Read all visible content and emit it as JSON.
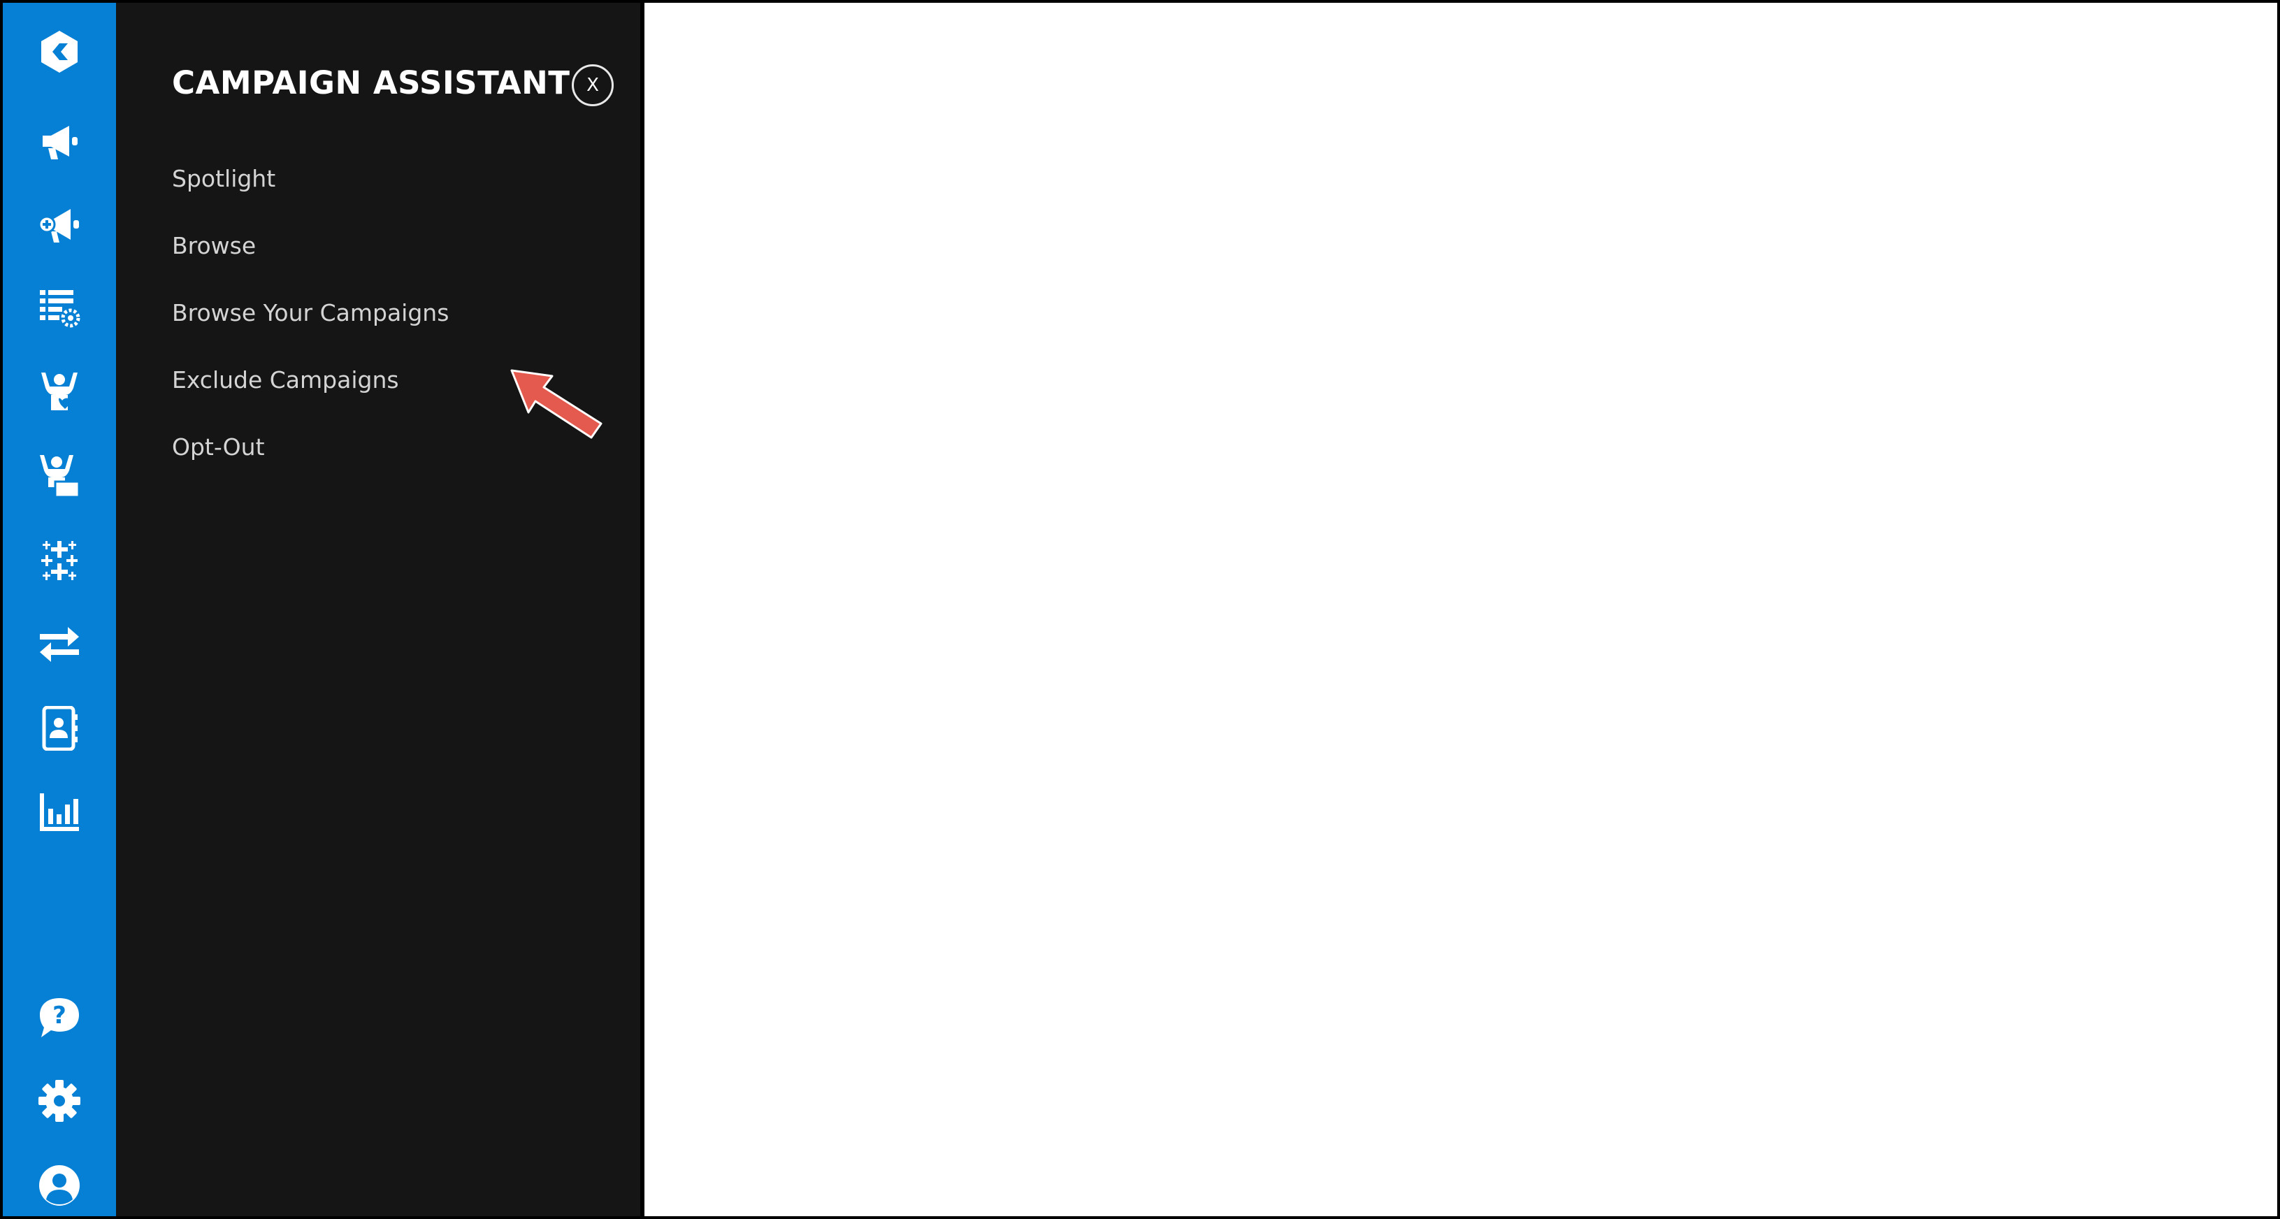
{
  "colors": {
    "rail": "#0680d4",
    "panel": "#151515",
    "title_text": "#ffffff",
    "menu_text": "#d4d4d4",
    "annotation_arrow": "#e55a4e"
  },
  "rail": {
    "top_icons": [
      "logo-icon",
      "megaphone-icon",
      "megaphone-plus-icon",
      "list-settings-icon",
      "volunteer-heart-icon",
      "volunteer-sign-icon",
      "tableau-icon",
      "transfer-arrows-icon",
      "contacts-icon",
      "bar-chart-icon"
    ],
    "bottom_icons": [
      "help-chat-icon",
      "gear-icon",
      "user-avatar-icon"
    ]
  },
  "panel": {
    "title": "CAMPAIGN ASSISTANT",
    "close_label": "X",
    "menu": [
      {
        "label": "Spotlight"
      },
      {
        "label": "Browse"
      },
      {
        "label": "Browse Your Campaigns"
      },
      {
        "label": "Exclude Campaigns"
      },
      {
        "label": "Opt-Out"
      }
    ]
  }
}
